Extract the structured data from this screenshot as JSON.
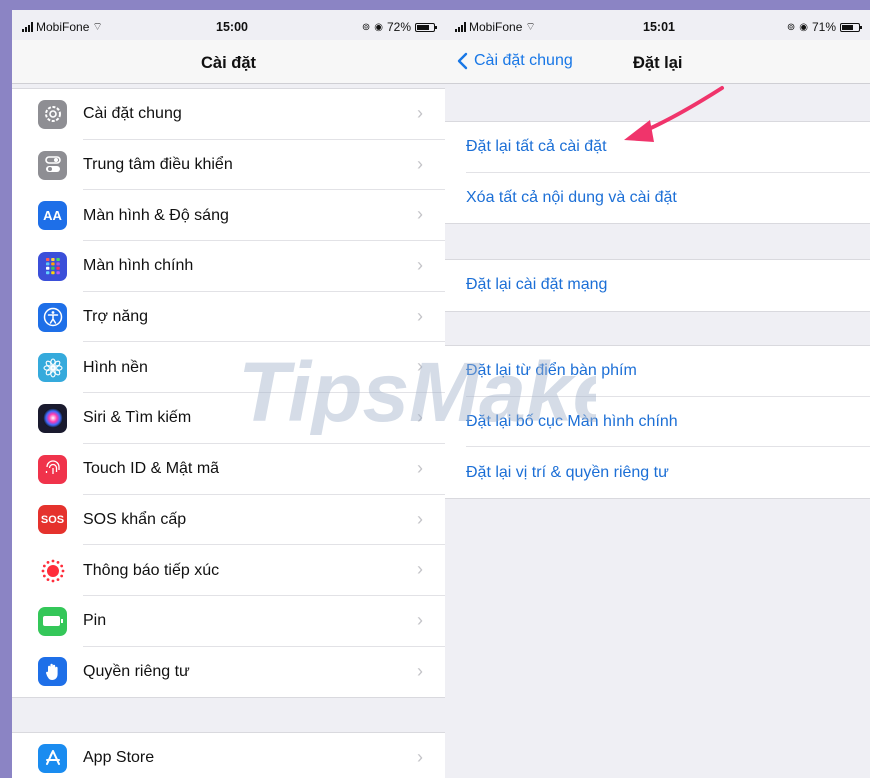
{
  "left": {
    "status": {
      "carrier": "MobiFone",
      "time": "15:00",
      "battery": "72%",
      "battery_level": 0.72
    },
    "title": "Cài đặt",
    "items": [
      {
        "label": "Cài đặt chung",
        "icon": "gear-icon",
        "color": "#8e8e93"
      },
      {
        "label": "Trung tâm điều khiển",
        "icon": "toggles-icon",
        "color": "#8e8e93"
      },
      {
        "label": "Màn hình & Độ sáng",
        "icon": "display-text-icon",
        "color": "#1e6fe8"
      },
      {
        "label": "Màn hình chính",
        "icon": "home-grid-icon",
        "color": "#3b4fd9"
      },
      {
        "label": "Trợ năng",
        "icon": "accessibility-icon",
        "color": "#1e6fe8"
      },
      {
        "label": "Hình nền",
        "icon": "wallpaper-flower-icon",
        "color": "#35aadc"
      },
      {
        "label": "Siri & Tìm kiếm",
        "icon": "siri-icon",
        "color": "#1a1a2e"
      },
      {
        "label": "Touch ID & Mật mã",
        "icon": "fingerprint-icon",
        "color": "#f0334b"
      },
      {
        "label": "SOS khẩn cấp",
        "icon": "sos-icon",
        "icon_text": "SOS",
        "color": "#e5322d"
      },
      {
        "label": "Thông báo tiếp xúc",
        "icon": "exposure-notification-icon",
        "color": "#ffffff"
      },
      {
        "label": "Pin",
        "icon": "battery-icon",
        "color": "#34c759"
      },
      {
        "label": "Quyền riêng tư",
        "icon": "hand-privacy-icon",
        "color": "#1e6fe8"
      }
    ],
    "store": {
      "label": "App Store",
      "icon": "app-store-icon",
      "color": "#1a8cf0"
    }
  },
  "right": {
    "status": {
      "carrier": "MobiFone",
      "time": "15:01",
      "battery": "71%",
      "battery_level": 0.71
    },
    "back_label": "Cài đặt chung",
    "title": "Đặt lại",
    "group1": [
      "Đặt lại tất cả cài đặt",
      "Xóa tất cả nội dung và cài đặt"
    ],
    "group2": [
      "Đặt lại cài đặt mạng"
    ],
    "group3": [
      "Đặt lại từ điển bàn phím",
      "Đặt lại bố cục Màn hình chính",
      "Đặt lại vị trí & quyền riêng tư"
    ]
  },
  "watermark": "TipsMake",
  "colors": {
    "frame": "#8b84c4",
    "link": "#1c6fd6",
    "arrow": "#f0346b"
  }
}
